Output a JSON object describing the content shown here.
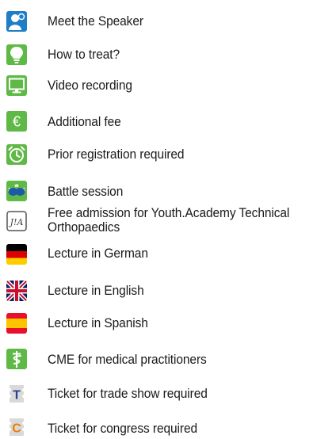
{
  "legend": {
    "items": [
      {
        "icon": "speaker-icon",
        "label": "Meet the Speaker"
      },
      {
        "icon": "lightbulb-icon",
        "label": "How to treat?"
      },
      {
        "icon": "monitor-icon",
        "label": "Video recording"
      },
      {
        "icon": "euro-icon",
        "label": "Additional fee"
      },
      {
        "icon": "alarm-clock-icon",
        "label": "Prior registration required"
      },
      {
        "icon": "boxing-gloves-icon",
        "label": "Battle session"
      },
      {
        "icon": "youth-academy-icon",
        "label": "Free admission for Youth.Academy Technical",
        "label2": "Orthopaedics"
      },
      {
        "icon": "german-flag-icon",
        "label": "Lecture in German"
      },
      {
        "icon": "uk-flag-icon",
        "label": "Lecture in English"
      },
      {
        "icon": "spanish-flag-icon",
        "label": "Lecture in Spanish"
      },
      {
        "icon": "caduceus-icon",
        "label": "CME for medical practitioners"
      },
      {
        "icon": "trade-ticket-icon",
        "label": "Ticket for trade show required",
        "letter": "T"
      },
      {
        "icon": "congress-ticket-icon",
        "label": "Ticket for congress required",
        "letter": "C"
      }
    ]
  },
  "colors": {
    "green": "#5fb946",
    "blue": "#1e7ec8",
    "ticket_gray": "#d9d9d9",
    "trade_letter": "#2a3f8f",
    "congress_letter": "#ef7d00"
  }
}
